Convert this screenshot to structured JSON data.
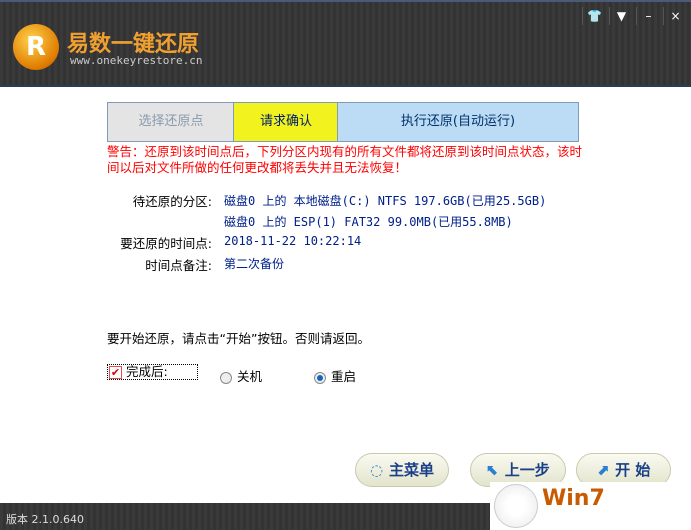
{
  "header": {
    "logo_text": "R",
    "title": "易数一键还原",
    "url": "www.onekeyrestore.cn",
    "window_buttons": [
      "skin-icon",
      "menu-icon",
      "minimize-icon",
      "close-icon"
    ]
  },
  "steps": [
    {
      "label": "选择还原点"
    },
    {
      "label": "请求确认"
    },
    {
      "label": "执行还原(自动运行)"
    }
  ],
  "warning": "警告：还原到该时间点后，下列分区内现有的所有文件都将还原到该时间点状态，该时间以后对文件所做的任何更改都将丢失并且无法恢复！",
  "info": {
    "partition_label": "待还原的分区:",
    "partitions": [
      "磁盘0 上的 本地磁盘(C:) NTFS 197.6GB(已用25.5GB)",
      "磁盘0 上的 ESP(1) FAT32 99.0MB(已用55.8MB)"
    ],
    "time_label": "要还原的时间点:",
    "time": "2018-11-22 10:22:14",
    "note_label": "时间点备注:",
    "note": "第二次备份"
  },
  "hint": "要开始还原，请点击“开始”按钮。否则请返回。",
  "after": {
    "label": "完成后:",
    "checked": true,
    "options": [
      {
        "label": "关机",
        "selected": false
      },
      {
        "label": "重启",
        "selected": true
      }
    ]
  },
  "buttons": {
    "main_menu": "主菜单",
    "back": "上一步",
    "start": "开 始"
  },
  "footer": {
    "version": "版本 2.1.0.640"
  },
  "watermark": {
    "text": "Win7"
  }
}
